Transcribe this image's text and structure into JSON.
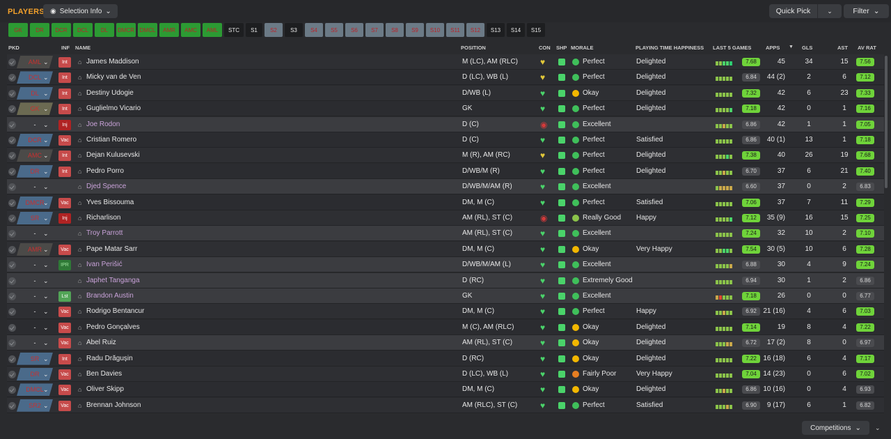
{
  "header": {
    "title": "PLAYERS",
    "selection_info": "Selection Info",
    "quick_pick": "Quick Pick",
    "filter": "Filter"
  },
  "positions": [
    {
      "label": "GK",
      "style": "green"
    },
    {
      "label": "DR",
      "style": "green"
    },
    {
      "label": "DCR",
      "style": "green"
    },
    {
      "label": "DCL",
      "style": "green"
    },
    {
      "label": "DL",
      "style": "green"
    },
    {
      "label": "DMCR",
      "style": "green"
    },
    {
      "label": "DMCL",
      "style": "green"
    },
    {
      "label": "AMR",
      "style": "green"
    },
    {
      "label": "AMC",
      "style": "green"
    },
    {
      "label": "AML",
      "style": "green"
    },
    {
      "label": "STC",
      "style": "black"
    },
    {
      "label": "S1",
      "style": "black"
    },
    {
      "label": "S2",
      "style": "grey"
    },
    {
      "label": "S3",
      "style": "black"
    },
    {
      "label": "S4",
      "style": "grey"
    },
    {
      "label": "S5",
      "style": "grey"
    },
    {
      "label": "S6",
      "style": "grey"
    },
    {
      "label": "S7",
      "style": "grey"
    },
    {
      "label": "S8",
      "style": "grey"
    },
    {
      "label": "S9",
      "style": "grey"
    },
    {
      "label": "S10",
      "style": "grey"
    },
    {
      "label": "S11",
      "style": "grey"
    },
    {
      "label": "S12",
      "style": "grey"
    },
    {
      "label": "S13",
      "style": "black"
    },
    {
      "label": "S14",
      "style": "black"
    },
    {
      "label": "S15",
      "style": "black"
    }
  ],
  "columns": {
    "pkd": "PKD",
    "inf": "INF",
    "name": "NAME",
    "position": "POSITION",
    "con": "CON",
    "shp": "SHP",
    "morale": "MORALE",
    "pth": "PLAYING TIME HAPPINESS",
    "last5": "LAST 5 GAMES",
    "apps": "APPS",
    "gls": "GLS",
    "ast": "AST",
    "avrat": "AV RAT"
  },
  "players": [
    {
      "role": "AML",
      "role_style": "amber",
      "inf": "Int",
      "name": "James Maddison",
      "link": false,
      "pos": "M (LC), AM (RLC)",
      "con": "yellow",
      "morale": "Perfect",
      "morale_color": "#3fbf5a",
      "pth": "Delighted",
      "form": [
        "#8bc34a",
        "#8bc34a",
        "#4ad36a",
        "#4ad36a",
        "#2ecc71"
      ],
      "form_rat": "7.68",
      "form_hi": true,
      "apps": "45",
      "gls": "34",
      "ast": "15",
      "av": "7.56",
      "av_hi": true
    },
    {
      "role": "DCL",
      "role_style": "blue",
      "inf": "Int",
      "name": "Micky van de Ven",
      "link": false,
      "pos": "D (LC), WB (L)",
      "con": "yellow",
      "morale": "Perfect",
      "morale_color": "#3fbf5a",
      "pth": "Delighted",
      "form": [
        "#8bc34a",
        "#8bc34a",
        "#8bc34a",
        "#8bc34a",
        "#8bc34a"
      ],
      "form_rat": "6.84",
      "form_hi": false,
      "apps": "44 (2)",
      "gls": "2",
      "ast": "6",
      "av": "7.12",
      "av_hi": true
    },
    {
      "role": "DL",
      "role_style": "blue",
      "inf": "Int",
      "name": "Destiny Udogie",
      "link": false,
      "pos": "D/WB (L)",
      "con": "green",
      "morale": "Okay",
      "morale_color": "#f2b700",
      "pth": "Delighted",
      "form": [
        "#8bc34a",
        "#8bc34a",
        "#8bc34a",
        "#8bc34a",
        "#8bc34a"
      ],
      "form_rat": "7.32",
      "form_hi": true,
      "apps": "42",
      "gls": "6",
      "ast": "23",
      "av": "7.33",
      "av_hi": true
    },
    {
      "role": "GK",
      "role_style": "olive",
      "inf": "Int",
      "name": "Guglielmo Vicario",
      "link": false,
      "pos": "GK",
      "con": "green",
      "morale": "Perfect",
      "morale_color": "#3fbf5a",
      "pth": "Delighted",
      "form": [
        "#8bc34a",
        "#8bc34a",
        "#8bc34a",
        "#8bc34a",
        "#4ad36a"
      ],
      "form_rat": "7.18",
      "form_hi": true,
      "apps": "42",
      "gls": "0",
      "ast": "1",
      "av": "7.16",
      "av_hi": true
    },
    {
      "role": "-",
      "role_style": "none",
      "inf": "Inj",
      "name": "Joe Rodon",
      "link": true,
      "pos": "D (C)",
      "con": "red",
      "morale": "Excellent",
      "morale_color": "#3fbf5a",
      "pth": "",
      "form": [
        "#8bc34a",
        "#8bc34a",
        "#c9a84a",
        "#8bc34a",
        "#8bc34a"
      ],
      "form_rat": "6.86",
      "form_hi": false,
      "apps": "42",
      "gls": "1",
      "ast": "1",
      "av": "7.05",
      "av_hi": true,
      "hl": true
    },
    {
      "role": "DCR",
      "role_style": "blue",
      "inf": "Vac",
      "name": "Cristian Romero",
      "link": false,
      "pos": "D (C)",
      "con": "green",
      "morale": "Perfect",
      "morale_color": "#3fbf5a",
      "pth": "Satisfied",
      "form": [
        "#8bc34a",
        "#8bc34a",
        "#8bc34a",
        "#8bc34a",
        "#8bc34a"
      ],
      "form_rat": "6.86",
      "form_hi": false,
      "apps": "40 (1)",
      "gls": "13",
      "ast": "1",
      "av": "7.18",
      "av_hi": true
    },
    {
      "role": "AMC",
      "role_style": "amber",
      "inf": "Int",
      "name": "Dejan Kulusevski",
      "link": false,
      "pos": "M (R), AM (RC)",
      "con": "yellow",
      "morale": "Perfect",
      "morale_color": "#3fbf5a",
      "pth": "Delighted",
      "form": [
        "#8bc34a",
        "#8bc34a",
        "#8bc34a",
        "#4ad36a",
        "#8bc34a"
      ],
      "form_rat": "7.38",
      "form_hi": true,
      "apps": "40",
      "gls": "26",
      "ast": "19",
      "av": "7.68",
      "av_hi": true
    },
    {
      "role": "DR",
      "role_style": "blue",
      "inf": "Int",
      "name": "Pedro Porro",
      "link": false,
      "pos": "D/WB/M (R)",
      "con": "green",
      "morale": "Perfect",
      "morale_color": "#3fbf5a",
      "pth": "Delighted",
      "form": [
        "#8bc34a",
        "#8bc34a",
        "#c9a84a",
        "#8bc34a",
        "#8bc34a"
      ],
      "form_rat": "6.70",
      "form_hi": false,
      "apps": "37",
      "gls": "6",
      "ast": "21",
      "av": "7.40",
      "av_hi": true
    },
    {
      "role": "-",
      "role_style": "none",
      "inf": "",
      "name": "Djed Spence",
      "link": true,
      "pos": "D/WB/M/AM (R)",
      "con": "green",
      "morale": "Excellent",
      "morale_color": "#3fbf5a",
      "pth": "",
      "form": [
        "#8bc34a",
        "#c9a84a",
        "#c9a84a",
        "#c9a84a",
        "#c9a84a"
      ],
      "form_rat": "6.60",
      "form_hi": false,
      "apps": "37",
      "gls": "0",
      "ast": "2",
      "av": "6.83",
      "av_hi": false,
      "hl": true
    },
    {
      "role": "DMCR",
      "role_style": "blue",
      "inf": "Vac",
      "name": "Yves Bissouma",
      "link": false,
      "pos": "DM, M (C)",
      "con": "green",
      "morale": "Perfect",
      "morale_color": "#3fbf5a",
      "pth": "Satisfied",
      "form": [
        "#8bc34a",
        "#8bc34a",
        "#8bc34a",
        "#8bc34a",
        "#8bc34a"
      ],
      "form_rat": "7.06",
      "form_hi": true,
      "apps": "37",
      "gls": "7",
      "ast": "11",
      "av": "7.29",
      "av_hi": true
    },
    {
      "role": "SR",
      "role_style": "blue",
      "inf": "Inj",
      "name": "Richarlison",
      "link": false,
      "pos": "AM (RL), ST (C)",
      "con": "red",
      "morale": "Really Good",
      "morale_color": "#8bc34a",
      "pth": "Happy",
      "form": [
        "#8bc34a",
        "#8bc34a",
        "#8bc34a",
        "#8bc34a",
        "#4ad36a"
      ],
      "form_rat": "7.12",
      "form_hi": true,
      "apps": "35 (9)",
      "gls": "16",
      "ast": "15",
      "av": "7.25",
      "av_hi": true
    },
    {
      "role": "-",
      "role_style": "none",
      "inf": "",
      "name": "Troy Parrott",
      "link": true,
      "pos": "AM (RL), ST (C)",
      "con": "green",
      "morale": "Excellent",
      "morale_color": "#3fbf5a",
      "pth": "",
      "form": [
        "#8bc34a",
        "#8bc34a",
        "#8bc34a",
        "#8bc34a",
        "#8bc34a"
      ],
      "form_rat": "7.24",
      "form_hi": true,
      "apps": "32",
      "gls": "10",
      "ast": "2",
      "av": "7.10",
      "av_hi": true,
      "hl": true
    },
    {
      "role": "AMR",
      "role_style": "amber",
      "inf": "Vac",
      "name": "Pape Matar Sarr",
      "link": false,
      "pos": "DM, M (C)",
      "con": "green",
      "morale": "Okay",
      "morale_color": "#f2b700",
      "pth": "Very Happy",
      "form": [
        "#8bc34a",
        "#8bc34a",
        "#4ad36a",
        "#4ad36a",
        "#8bc34a"
      ],
      "form_rat": "7.54",
      "form_hi": true,
      "apps": "30 (5)",
      "gls": "10",
      "ast": "6",
      "av": "7.28",
      "av_hi": true
    },
    {
      "role": "-",
      "role_style": "none",
      "inf": "IPR",
      "name": "Ivan Perišić",
      "link": true,
      "pos": "D/WB/M/AM (L)",
      "con": "green",
      "morale": "Excellent",
      "morale_color": "#3fbf5a",
      "pth": "",
      "form": [
        "#8bc34a",
        "#8bc34a",
        "#8bc34a",
        "#8bc34a",
        "#c9a84a"
      ],
      "form_rat": "6.88",
      "form_hi": false,
      "apps": "30",
      "gls": "4",
      "ast": "9",
      "av": "7.24",
      "av_hi": true,
      "hl": true
    },
    {
      "role": "-",
      "role_style": "none",
      "inf": "",
      "name": "Japhet Tanganga",
      "link": true,
      "pos": "D (RC)",
      "con": "green",
      "morale": "Extremely Good",
      "morale_color": "#3fbf5a",
      "pth": "",
      "form": [
        "#8bc34a",
        "#8bc34a",
        "#8bc34a",
        "#8bc34a",
        "#8bc34a"
      ],
      "form_rat": "6.94",
      "form_hi": false,
      "apps": "30",
      "gls": "1",
      "ast": "2",
      "av": "6.86",
      "av_hi": false,
      "hl": true
    },
    {
      "role": "-",
      "role_style": "none",
      "inf": "Lst",
      "name": "Brandon Austin",
      "link": true,
      "pos": "GK",
      "con": "green",
      "morale": "Excellent",
      "morale_color": "#3fbf5a",
      "pth": "",
      "form": [
        "#c9a84a",
        "#e0452f",
        "#8bc34a",
        "#8bc34a",
        "#8bc34a"
      ],
      "form_rat": "7.18",
      "form_hi": true,
      "apps": "26",
      "gls": "0",
      "ast": "0",
      "av": "6.77",
      "av_hi": false,
      "hl": true
    },
    {
      "role": "-",
      "role_style": "none",
      "inf": "Vac",
      "name": "Rodrigo Bentancur",
      "link": false,
      "pos": "DM, M (C)",
      "con": "green",
      "morale": "Perfect",
      "morale_color": "#3fbf5a",
      "pth": "Happy",
      "form": [
        "#8bc34a",
        "#8bc34a",
        "#c9a84a",
        "#8bc34a",
        "#8bc34a"
      ],
      "form_rat": "6.92",
      "form_hi": false,
      "apps": "21 (16)",
      "gls": "4",
      "ast": "6",
      "av": "7.03",
      "av_hi": true
    },
    {
      "role": "-",
      "role_style": "none",
      "inf": "Vac",
      "name": "Pedro Gonçalves",
      "link": false,
      "pos": "M (C), AM (RLC)",
      "con": "green",
      "morale": "Okay",
      "morale_color": "#f2b700",
      "pth": "Delighted",
      "form": [
        "#8bc34a",
        "#8bc34a",
        "#8bc34a",
        "#8bc34a",
        "#8bc34a"
      ],
      "form_rat": "7.14",
      "form_hi": true,
      "apps": "19",
      "gls": "8",
      "ast": "4",
      "av": "7.22",
      "av_hi": true
    },
    {
      "role": "-",
      "role_style": "none",
      "inf": "Vac",
      "name": "Abel Ruiz",
      "link": false,
      "pos": "AM (RL), ST (C)",
      "con": "green",
      "morale": "Okay",
      "morale_color": "#f2b700",
      "pth": "Delighted",
      "form": [
        "#8bc34a",
        "#8bc34a",
        "#8bc34a",
        "#c9a84a",
        "#c9a84a"
      ],
      "form_rat": "6.72",
      "form_hi": false,
      "apps": "17 (2)",
      "gls": "8",
      "ast": "0",
      "av": "6.97",
      "av_hi": false,
      "hl": true
    },
    {
      "role": "SR",
      "role_style": "blue",
      "inf": "Int",
      "name": "Radu Drăgușin",
      "link": false,
      "pos": "D (RC)",
      "con": "green",
      "morale": "Okay",
      "morale_color": "#f2b700",
      "pth": "Delighted",
      "form": [
        "#8bc34a",
        "#8bc34a",
        "#8bc34a",
        "#8bc34a",
        "#8bc34a"
      ],
      "form_rat": "7.22",
      "form_hi": true,
      "apps": "16 (18)",
      "gls": "6",
      "ast": "4",
      "av": "7.17",
      "av_hi": true
    },
    {
      "role": "DR",
      "role_style": "blue",
      "inf": "Vac",
      "name": "Ben Davies",
      "link": false,
      "pos": "D (LC), WB (L)",
      "con": "green",
      "morale": "Fairly Poor",
      "morale_color": "#e67e22",
      "pth": "Very Happy",
      "form": [
        "#8bc34a",
        "#8bc34a",
        "#8bc34a",
        "#8bc34a",
        "#8bc34a"
      ],
      "form_rat": "7.04",
      "form_hi": true,
      "apps": "14 (23)",
      "gls": "0",
      "ast": "6",
      "av": "7.02",
      "av_hi": true
    },
    {
      "role": "DMCL",
      "role_style": "blue",
      "inf": "Vac",
      "name": "Oliver Skipp",
      "link": false,
      "pos": "DM, M (C)",
      "con": "green",
      "morale": "Okay",
      "morale_color": "#f2b700",
      "pth": "Delighted",
      "form": [
        "#8bc34a",
        "#8bc34a",
        "#c9a84a",
        "#8bc34a",
        "#8bc34a"
      ],
      "form_rat": "6.86",
      "form_hi": false,
      "apps": "10 (16)",
      "gls": "0",
      "ast": "4",
      "av": "6.93",
      "av_hi": false
    },
    {
      "role": "SR2",
      "role_style": "blue",
      "inf": "Vac",
      "name": "Brennan Johnson",
      "link": false,
      "pos": "AM (RLC), ST (C)",
      "con": "green",
      "morale": "Perfect",
      "morale_color": "#3fbf5a",
      "pth": "Satisfied",
      "form": [
        "#8bc34a",
        "#8bc34a",
        "#8bc34a",
        "#c9a84a",
        "#8bc34a"
      ],
      "form_rat": "6.90",
      "form_hi": false,
      "apps": "9 (17)",
      "gls": "6",
      "ast": "1",
      "av": "6.82",
      "av_hi": false
    }
  ],
  "footer": {
    "competitions": "Competitions"
  },
  "colors": {
    "accent": "#f2a02b",
    "rating_high": "#6fd33a",
    "rating_mid": "#4a4b4f"
  }
}
